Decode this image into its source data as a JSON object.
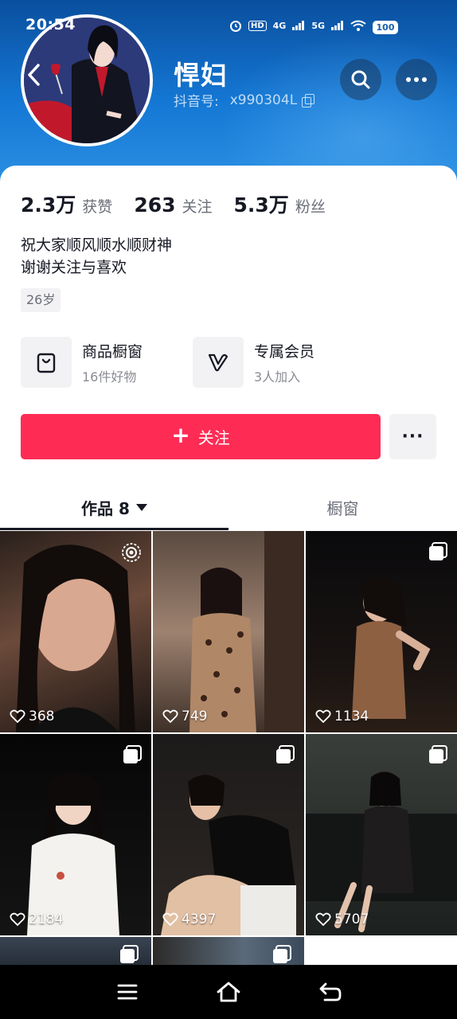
{
  "status_bar": {
    "time": "20:54",
    "network_a": "HD",
    "network_b": "4G",
    "network_c": "5G",
    "battery": "100"
  },
  "profile": {
    "nickname": "悍妇",
    "id_label": "抖音号:",
    "id_value": "x990304L",
    "stats": [
      {
        "value": "2.3万",
        "label": "获赞"
      },
      {
        "value": "263",
        "label": "关注"
      },
      {
        "value": "5.3万",
        "label": "粉丝"
      }
    ],
    "bio_lines": [
      "祝大家顺风顺水顺财神",
      "谢谢关注与喜欢"
    ],
    "age_tag": "26岁"
  },
  "entries": [
    {
      "title": "商品橱窗",
      "subtitle": "16件好物",
      "icon": "shopping-bag-icon"
    },
    {
      "title": "专属会员",
      "subtitle": "3人加入",
      "icon": "member-v-icon"
    }
  ],
  "actions": {
    "follow_plus": "+",
    "follow_label": "关注",
    "more_label": "···"
  },
  "tabs": {
    "works_label": "作品 8",
    "shop_label": "橱窗"
  },
  "grid": [
    {
      "likes": "368",
      "badge": "live-icon"
    },
    {
      "likes": "749",
      "badge": ""
    },
    {
      "likes": "1134",
      "badge": "multi-image-icon"
    },
    {
      "likes": "2184",
      "badge": "multi-image-icon"
    },
    {
      "likes": "4397",
      "badge": "multi-image-icon"
    },
    {
      "likes": "5707",
      "badge": "multi-image-icon"
    }
  ],
  "colors": {
    "accent": "#fe2c55",
    "header_top": "#0a4f9e",
    "header_bottom": "#2a8fe3"
  }
}
